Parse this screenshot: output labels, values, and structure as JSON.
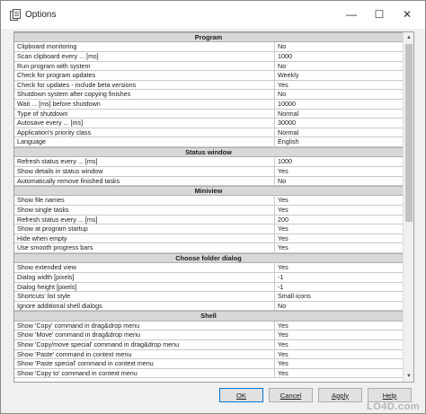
{
  "window": {
    "title": "Options"
  },
  "titlebar": {
    "minimize": "—",
    "maximize": "☐",
    "close": "✕"
  },
  "sections": [
    {
      "title": "Program",
      "rows": [
        {
          "name": "Clipboard monitoring",
          "value": "No"
        },
        {
          "name": "Scan clipboard every ... [ms]",
          "value": "1000"
        },
        {
          "name": "Run program with system",
          "value": "No"
        },
        {
          "name": "Check for program updates",
          "value": "Weekly"
        },
        {
          "name": "Check for updates - include beta versions",
          "value": "Yes"
        },
        {
          "name": "Shutdown system after copying finishes",
          "value": "No"
        },
        {
          "name": "Wait ... [ms] before shutdown",
          "value": "10000"
        },
        {
          "name": "Type of shutdown",
          "value": "Normal"
        },
        {
          "name": "Autosave every ... [ms]",
          "value": "30000"
        },
        {
          "name": "Application's priority class",
          "value": "Normal"
        },
        {
          "name": "Language",
          "value": "English"
        }
      ]
    },
    {
      "title": "Status window",
      "rows": [
        {
          "name": "Refresh status every ... [ms]",
          "value": "1000"
        },
        {
          "name": "Show details in status window",
          "value": "Yes"
        },
        {
          "name": "Automatically remove finished tasks",
          "value": "No"
        }
      ]
    },
    {
      "title": "Miniview",
      "rows": [
        {
          "name": "Show file names",
          "value": "Yes"
        },
        {
          "name": "Show single tasks",
          "value": "Yes"
        },
        {
          "name": "Refresh status every ... [ms]",
          "value": "200"
        },
        {
          "name": "Show at program startup",
          "value": "Yes"
        },
        {
          "name": "Hide when empty",
          "value": "Yes"
        },
        {
          "name": "Use smooth progress bars",
          "value": "Yes"
        }
      ]
    },
    {
      "title": "Choose folder dialog",
      "rows": [
        {
          "name": "Show extended view",
          "value": "Yes"
        },
        {
          "name": "Dialog width [pixels]",
          "value": "-1"
        },
        {
          "name": "Dialog height [pixels]",
          "value": "-1"
        },
        {
          "name": "Shortcuts' list style",
          "value": "Small icons"
        },
        {
          "name": "Ignore additional shell dialogs",
          "value": "No"
        }
      ]
    },
    {
      "title": "Shell",
      "rows": [
        {
          "name": "Show 'Copy' command in drag&drop menu",
          "value": "Yes"
        },
        {
          "name": "Show 'Move' command in drag&drop menu",
          "value": "Yes"
        },
        {
          "name": "Show 'Copy/move special' command in drag&drop menu",
          "value": "Yes"
        },
        {
          "name": "Show 'Paste' command in context menu",
          "value": "Yes"
        },
        {
          "name": "Show 'Paste special' command in context menu",
          "value": "Yes"
        },
        {
          "name": "Show 'Copy to' command in context menu",
          "value": "Yes"
        }
      ]
    }
  ],
  "buttons": {
    "ok": "OK",
    "cancel": "Cancel",
    "apply": "Apply",
    "help": "Help"
  },
  "watermark": "LO4D.com"
}
